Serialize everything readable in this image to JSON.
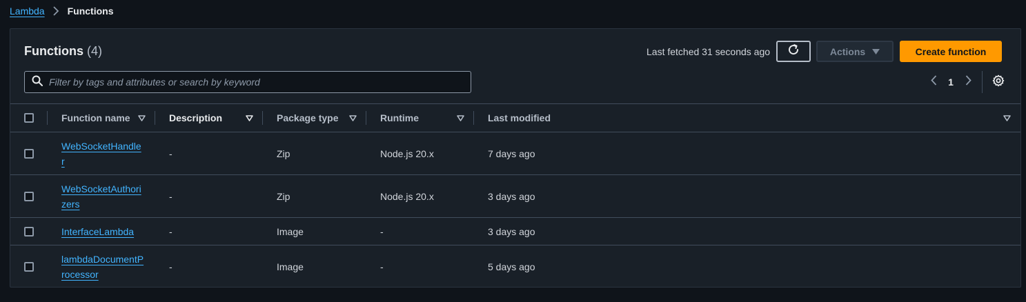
{
  "breadcrumb": {
    "parent": "Lambda",
    "current": "Functions"
  },
  "header": {
    "title": "Functions",
    "count": "(4)",
    "last_fetched": "Last fetched 31 seconds ago",
    "actions_label": "Actions",
    "create_label": "Create function"
  },
  "search": {
    "placeholder": "Filter by tags and attributes or search by keyword",
    "value": ""
  },
  "pagination": {
    "current_page": "1"
  },
  "table": {
    "columns": [
      "Function name",
      "Description",
      "Package type",
      "Runtime",
      "Last modified"
    ],
    "sorted_column": "Description",
    "rows": [
      {
        "name": "WebSocketHandler",
        "description": "-",
        "package_type": "Zip",
        "runtime": "Node.js 20.x",
        "last_modified": "7 days ago"
      },
      {
        "name": "WebSocketAuthorizers",
        "description": "-",
        "package_type": "Zip",
        "runtime": "Node.js 20.x",
        "last_modified": "3 days ago"
      },
      {
        "name": "InterfaceLambda",
        "description": "-",
        "package_type": "Image",
        "runtime": "-",
        "last_modified": "3 days ago"
      },
      {
        "name": "lambdaDocumentProcessor",
        "description": "-",
        "package_type": "Image",
        "runtime": "-",
        "last_modified": "5 days ago"
      }
    ]
  },
  "colors": {
    "background": "#0f141a",
    "panel": "#192028",
    "link": "#42b4ff",
    "primary_button": "#ff9900"
  },
  "icons": [
    "chevron-right-icon",
    "refresh-icon",
    "caret-down-icon",
    "search-icon",
    "chevron-left-icon",
    "settings-gear-icon",
    "sort-caret-icon"
  ]
}
